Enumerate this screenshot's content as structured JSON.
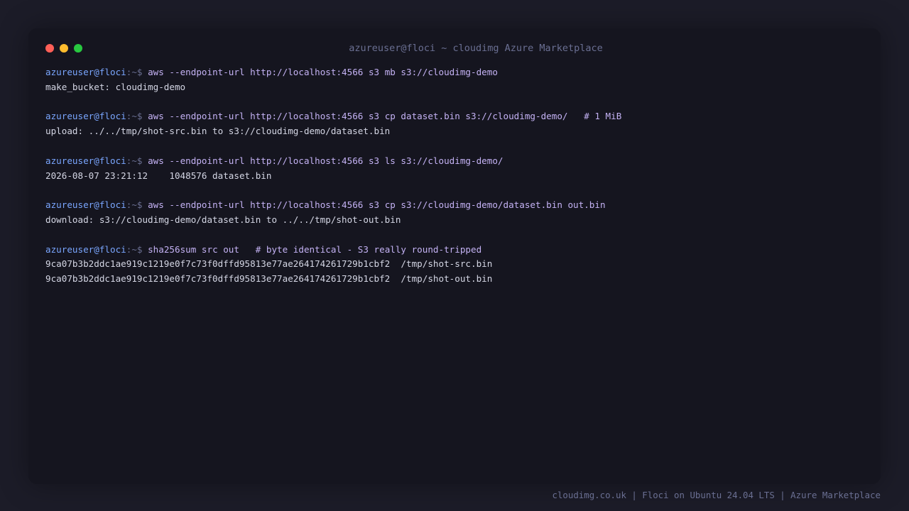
{
  "window": {
    "title": "azureuser@floci ~ cloudimg Azure Marketplace",
    "controls": {
      "close_color": "#ff5f57",
      "minimize_color": "#febc2e",
      "maximize_color": "#28c840"
    }
  },
  "prompt": {
    "user_host": "azureuser@floci",
    "path": ":~$ "
  },
  "terminal": {
    "blocks": [
      {
        "command": "aws --endpoint-url http://localhost:4566 s3 mb s3://cloudimg-demo",
        "output": [
          "make_bucket: cloudimg-demo"
        ]
      },
      {
        "command": "aws --endpoint-url http://localhost:4566 s3 cp dataset.bin s3://cloudimg-demo/   # 1 MiB",
        "output": [
          "upload: ../../tmp/shot-src.bin to s3://cloudimg-demo/dataset.bin"
        ]
      },
      {
        "command": "aws --endpoint-url http://localhost:4566 s3 ls s3://cloudimg-demo/",
        "output": [
          "2026-08-07 23:21:12    1048576 dataset.bin"
        ]
      },
      {
        "command": "aws --endpoint-url http://localhost:4566 s3 cp s3://cloudimg-demo/dataset.bin out.bin",
        "output": [
          "download: s3://cloudimg-demo/dataset.bin to ../../tmp/shot-out.bin"
        ]
      },
      {
        "command": "sha256sum src out   # byte identical - S3 really round-tripped",
        "output": [
          "9ca07b3b2ddc1ae919c1219e0f7c73f0dffd95813e77ae264174261729b1cbf2  /tmp/shot-src.bin",
          "9ca07b3b2ddc1ae919c1219e0f7c73f0dffd95813e77ae264174261729b1cbf2  /tmp/shot-out.bin"
        ]
      }
    ]
  },
  "footer": {
    "text": "cloudimg.co.uk | Floci on Ubuntu 24.04 LTS | Azure Marketplace"
  }
}
